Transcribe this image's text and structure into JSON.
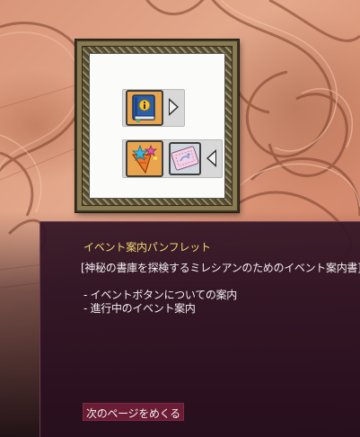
{
  "background": {
    "base_color": "#dc9a7d",
    "line_color": "#7a3e2a"
  },
  "icon_frame": {
    "row1": {
      "item_icon": "event-book-icon",
      "arrow_icon": "arrow-right-icon"
    },
    "row2": {
      "item_icon": "star-carrot-icon",
      "ticket_icon": "event-ticket-icon",
      "arrow_icon": "arrow-left-icon"
    }
  },
  "panel": {
    "title": "イベント案内パンフレット",
    "title_color": "#f1d873",
    "intro": "[神秘の書庫を探検するミレシアンのためのイベント案内書]",
    "items": [
      "- イベントボタンについての案内",
      "- 進行中のイベント案内"
    ],
    "next_button_label": "次のページをめくる",
    "accent_color": "#6a1c34"
  }
}
